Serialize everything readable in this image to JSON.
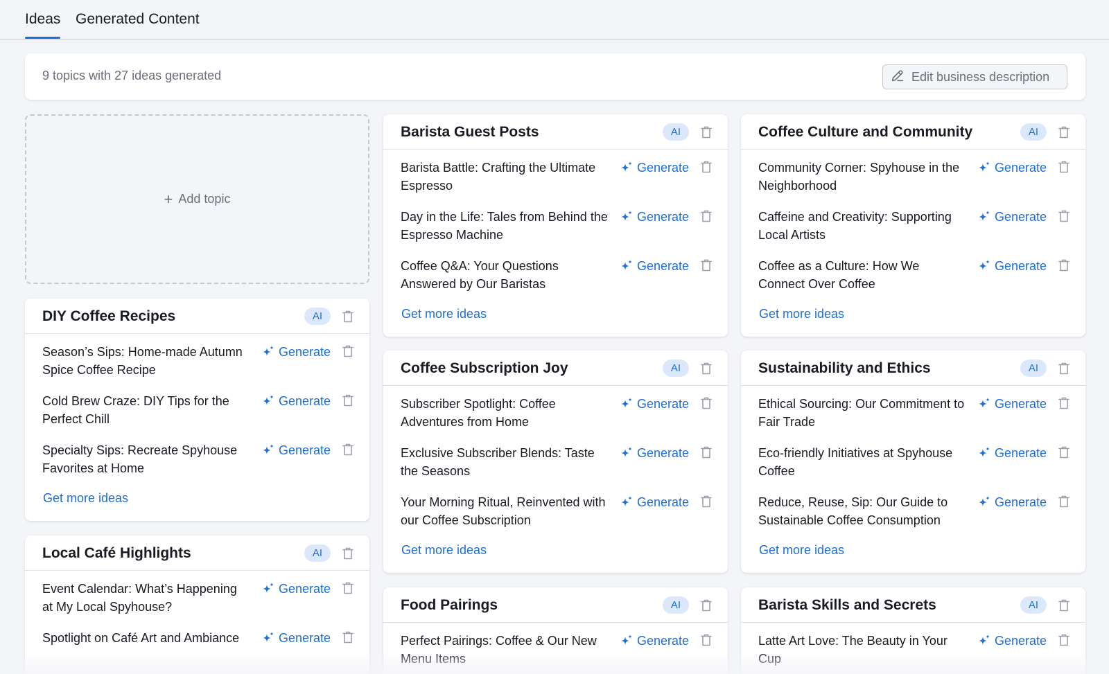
{
  "tabs": [
    {
      "label": "Ideas",
      "active": true
    },
    {
      "label": "Generated Content",
      "active": false
    }
  ],
  "summary": {
    "text": "9 topics with 27 ideas generated",
    "edit_label": "Edit business description"
  },
  "add_topic_label": "Add topic",
  "badge_label": "AI",
  "generate_label": "Generate",
  "more_label": "Get more ideas",
  "colors": {
    "accent": "#1d6fd6",
    "badge_bg": "#dbe8fb",
    "muted": "#6c6e79"
  },
  "icons": {
    "edit": "pencil-icon",
    "generate": "sparkle-icon",
    "delete": "trash-icon",
    "add": "plus-icon"
  },
  "topics": [
    {
      "title": "Barista Guest Posts",
      "ideas": [
        "Barista Battle: Crafting the Ultimate Espresso",
        "Day in the Life: Tales from Behind the Espresso Machine",
        "Coffee Q&A: Your Questions Answered by Our Baristas"
      ]
    },
    {
      "title": "Coffee Culture and Community",
      "ideas": [
        "Community Corner: Spyhouse in the Neighborhood",
        "Caffeine and Creativity: Supporting Local Artists",
        "Coffee as a Culture: How We Connect Over Coffee"
      ]
    },
    {
      "title": "DIY Coffee Recipes",
      "ideas": [
        "Season’s Sips: Home-made Autumn Spice Coffee Recipe",
        "Cold Brew Craze: DIY Tips for the Perfect Chill",
        "Specialty Sips: Recreate Spyhouse Favorites at Home"
      ]
    },
    {
      "title": "Coffee Subscription Joy",
      "ideas": [
        "Subscriber Spotlight: Coffee Adventures from Home",
        "Exclusive Subscriber Blends: Taste the Seasons",
        "Your Morning Ritual, Reinvented with our Coffee Subscription"
      ]
    },
    {
      "title": "Sustainability and Ethics",
      "ideas": [
        "Ethical Sourcing: Our Commitment to Fair Trade",
        "Eco-friendly Initiatives at Spyhouse Coffee",
        "Reduce, Reuse, Sip: Our Guide to Sustainable Coffee Consumption"
      ]
    },
    {
      "title": "Local Café Highlights",
      "ideas": [
        "Event Calendar: What’s Happening at My Local Spyhouse?",
        "Spotlight on Café Art and Ambiance"
      ]
    },
    {
      "title": "Food Pairings",
      "ideas": [
        "Perfect Pairings: Coffee & Our New Menu Items"
      ]
    },
    {
      "title": "Barista Skills and Secrets",
      "ideas": [
        "Latte Art Love: The Beauty in Your Cup"
      ]
    }
  ]
}
